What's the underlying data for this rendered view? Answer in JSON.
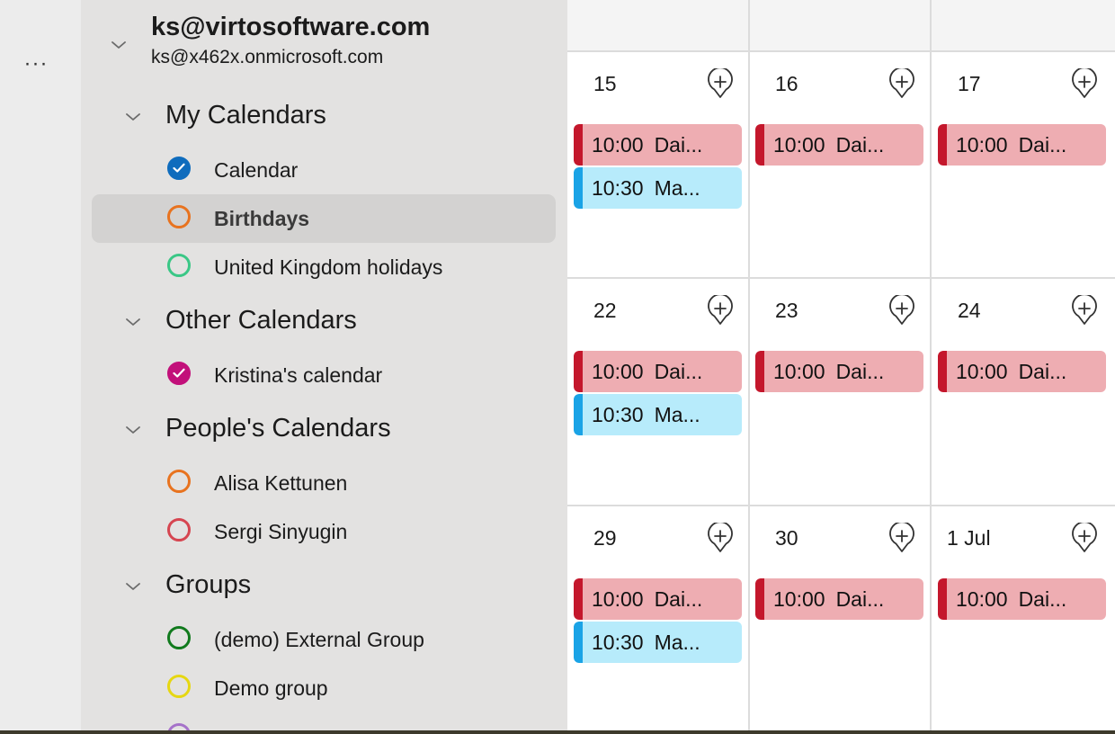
{
  "more_label": "···",
  "account": {
    "email": "ks@virtosoftware.com",
    "sub": "ks@x462x.onmicrosoft.com"
  },
  "groups": {
    "my": {
      "title": "My Calendars",
      "items": [
        {
          "label": "Calendar",
          "color": "#0f6cbd",
          "checked": true
        },
        {
          "label": "Birthdays",
          "color": "#e8731f",
          "checked": false,
          "selected": true
        },
        {
          "label": "United Kingdom holidays",
          "color": "#3ac786",
          "checked": false
        }
      ]
    },
    "other": {
      "title": "Other Calendars",
      "items": [
        {
          "label": "Kristina's calendar",
          "color": "#c2107a",
          "checked": true
        }
      ]
    },
    "people": {
      "title": "People's Calendars",
      "items": [
        {
          "label": "Alisa Kettunen",
          "color": "#e8731f",
          "checked": false
        },
        {
          "label": "Sergi Sinyugin",
          "color": "#d64550",
          "checked": false
        }
      ]
    },
    "groups": {
      "title": "Groups",
      "items": [
        {
          "label": "(demo) External Group",
          "color": "#117a1d",
          "checked": false
        },
        {
          "label": "Demo group",
          "color": "#e6d712",
          "checked": false
        },
        {
          "label": "",
          "color": "#a572c9",
          "checked": false
        }
      ]
    }
  },
  "calendar": {
    "weeks": [
      {
        "days": [
          {
            "label": "15",
            "events": [
              {
                "time": "10:00",
                "title": "Dai...",
                "color": "red"
              },
              {
                "time": "10:30",
                "title": "Ma...",
                "color": "blue"
              }
            ]
          },
          {
            "label": "16",
            "events": [
              {
                "time": "10:00",
                "title": "Dai...",
                "color": "red"
              }
            ]
          },
          {
            "label": "17",
            "events": [
              {
                "time": "10:00",
                "title": "Dai...",
                "color": "red"
              }
            ]
          }
        ]
      },
      {
        "days": [
          {
            "label": "22",
            "events": [
              {
                "time": "10:00",
                "title": "Dai...",
                "color": "red"
              },
              {
                "time": "10:30",
                "title": "Ma...",
                "color": "blue"
              }
            ]
          },
          {
            "label": "23",
            "events": [
              {
                "time": "10:00",
                "title": "Dai...",
                "color": "red"
              }
            ]
          },
          {
            "label": "24",
            "events": [
              {
                "time": "10:00",
                "title": "Dai...",
                "color": "red"
              }
            ]
          }
        ]
      },
      {
        "days": [
          {
            "label": "29",
            "events": [
              {
                "time": "10:00",
                "title": "Dai...",
                "color": "red"
              },
              {
                "time": "10:30",
                "title": "Ma...",
                "color": "blue"
              }
            ]
          },
          {
            "label": "30",
            "events": [
              {
                "time": "10:00",
                "title": "Dai...",
                "color": "red"
              }
            ]
          },
          {
            "label": "1 Jul",
            "events": [
              {
                "time": "10:00",
                "title": "Dai...",
                "color": "red"
              }
            ]
          }
        ]
      }
    ]
  }
}
